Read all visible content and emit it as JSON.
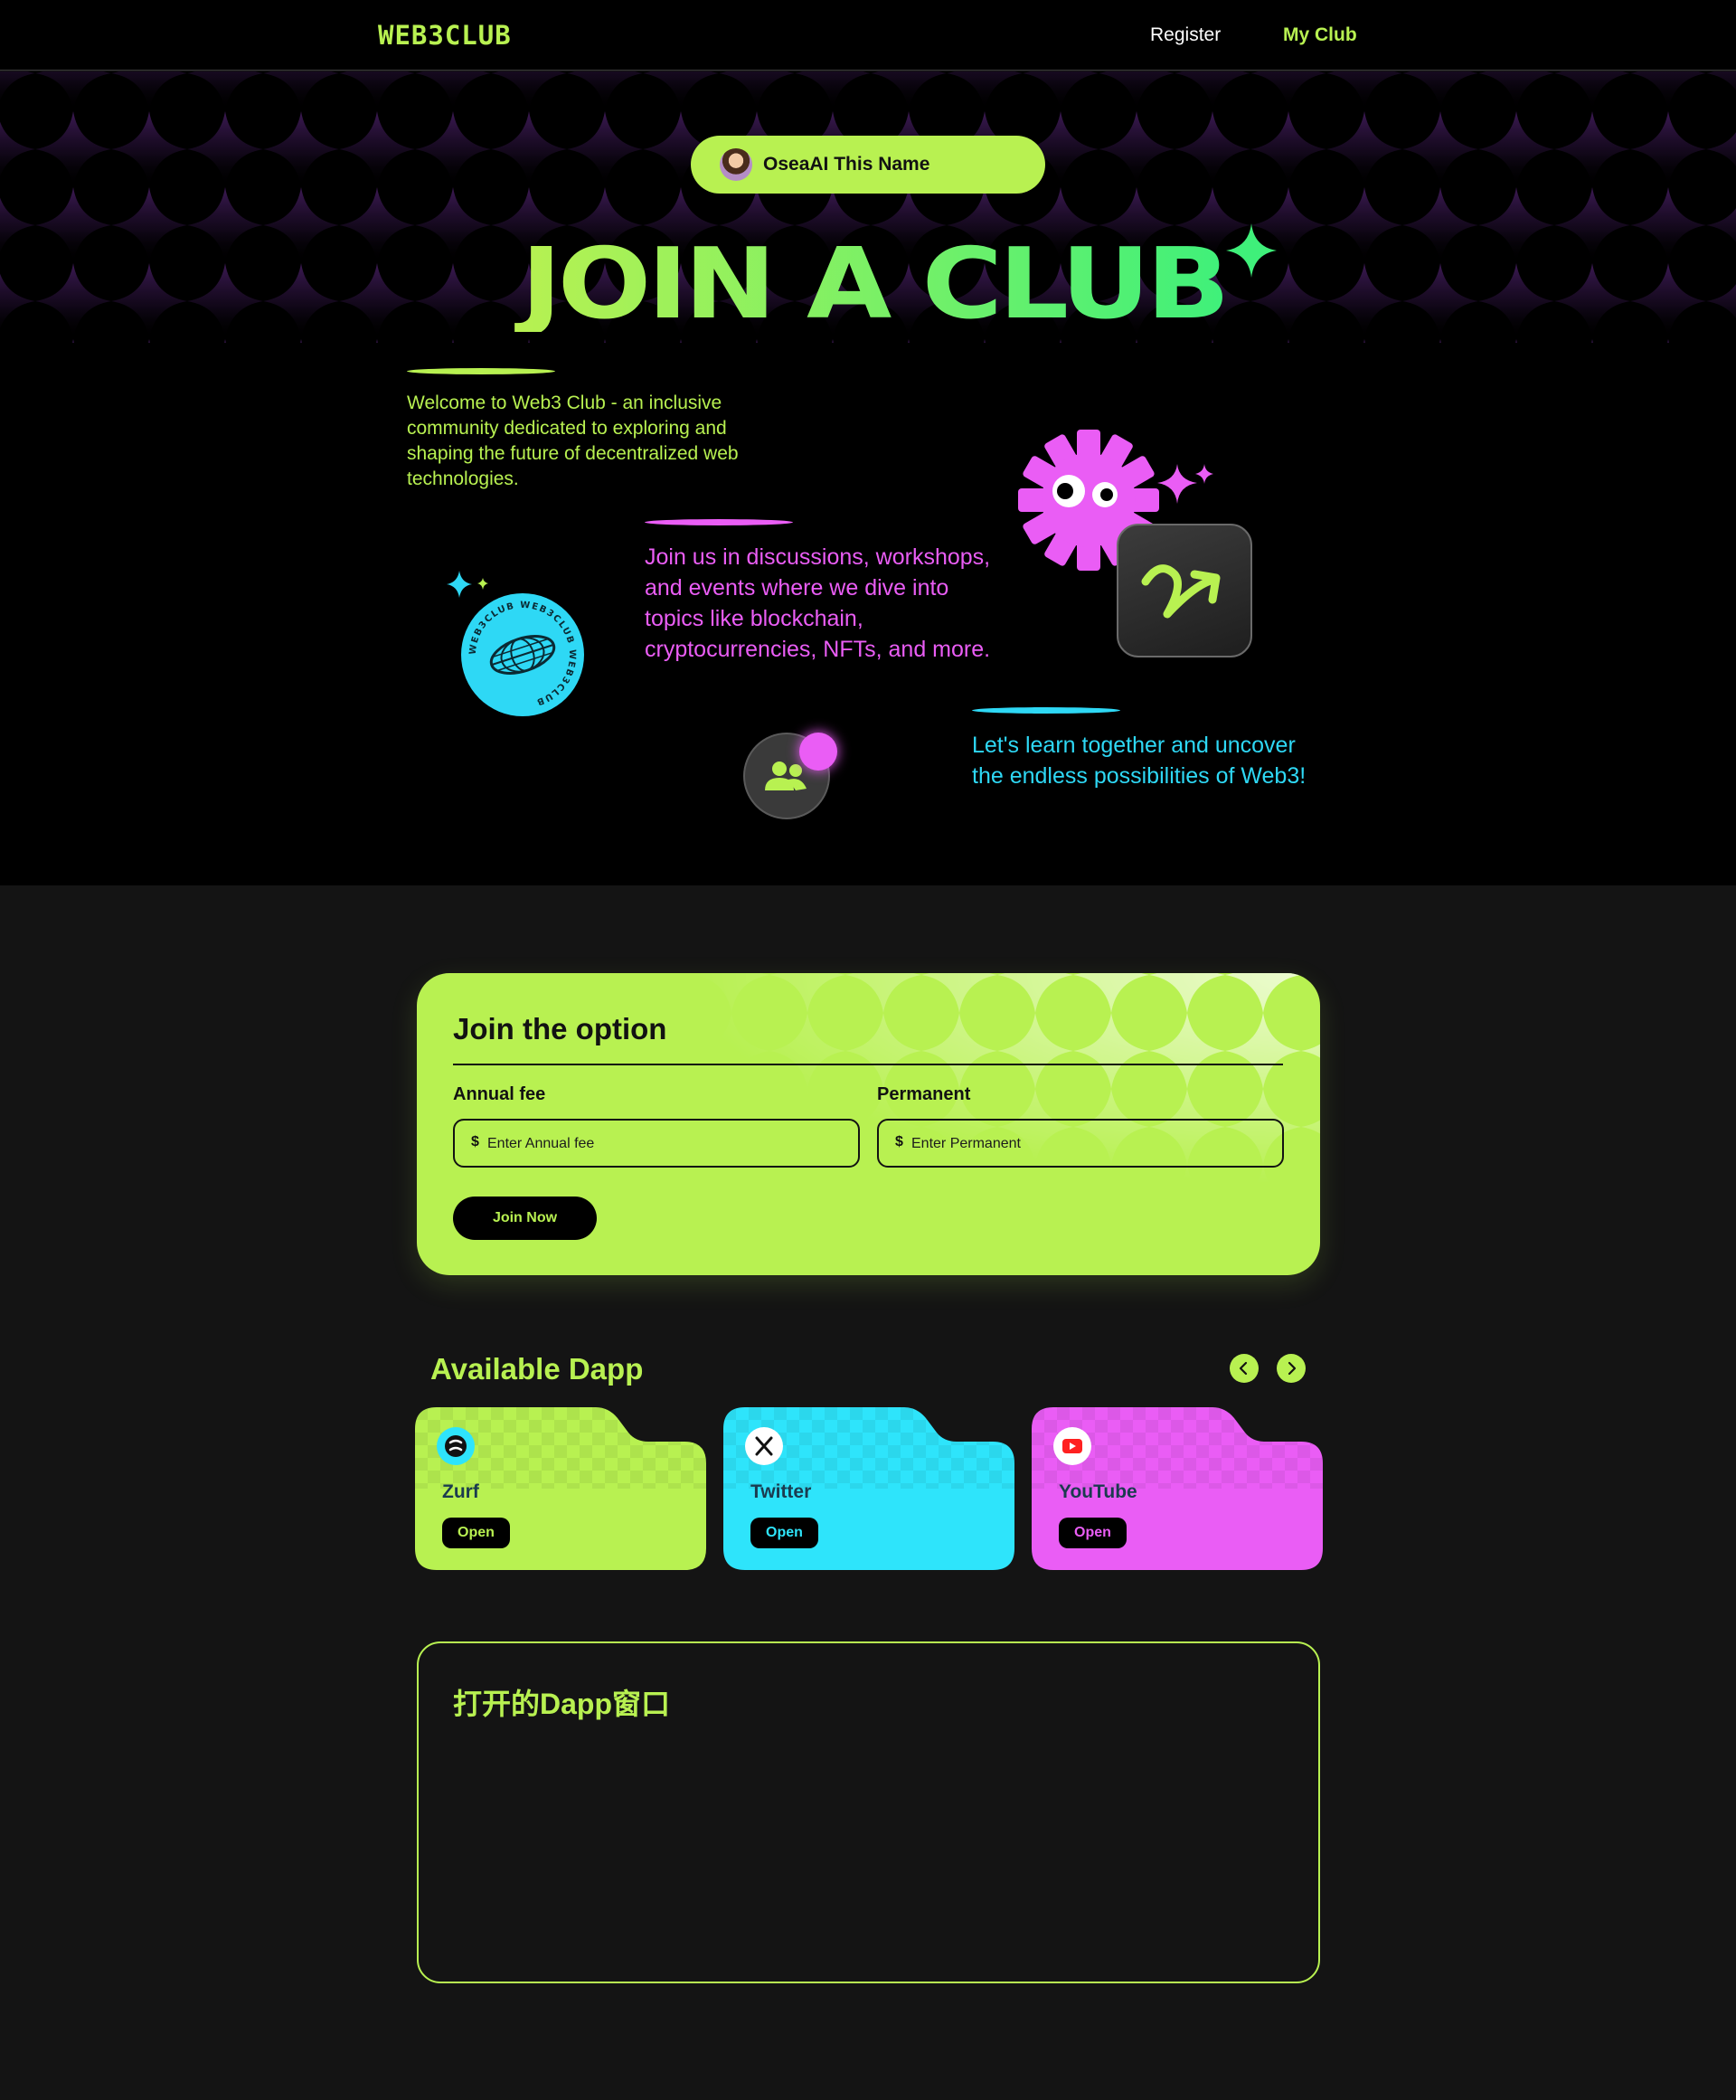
{
  "nav": {
    "logo": "WEB3CLUB",
    "links": [
      {
        "label": "Register"
      },
      {
        "label": "My Club"
      }
    ]
  },
  "hero": {
    "user_name": "OseaAI This Name",
    "title": "JOIN A CLUB",
    "paragraphs": [
      {
        "text": "Welcome to Web3 Club - an inclusive community dedicated to exploring and shaping the future of decentralized web technologies.",
        "color": "#b8f151"
      },
      {
        "text": "Join us in discussions, workshops, and events where we dive into topics like blockchain, cryptocurrencies, NFTs, and more.",
        "color": "#ea5df5"
      },
      {
        "text": "Let's learn together and uncover the endless possibilities of Web3!",
        "color": "#2ed8f5"
      }
    ],
    "badge_text": "WEB3CLUB WEB3CLUB WEB3CLUB",
    "tape_text": "WEB3CLUB"
  },
  "join": {
    "title": "Join the option",
    "annual_label": "Annual fee",
    "annual_placeholder": "Enter Annual fee",
    "permanent_label": "Permanent",
    "permanent_placeholder": "Enter Permanent",
    "currency": "$",
    "button": "Join Now"
  },
  "dapps": {
    "title": "Available Dapp",
    "items": [
      {
        "name": "Zurf",
        "button": "Open",
        "color": "#b8f151",
        "icon": "zurf-icon"
      },
      {
        "name": "Twitter",
        "button": "Open",
        "color": "#2ee4fb",
        "icon": "x-logo-icon"
      },
      {
        "name": "YouTube",
        "button": "Open",
        "color": "#ea5df5",
        "icon": "youtube-icon"
      }
    ]
  },
  "window": {
    "title": "打开的Dapp窗口"
  },
  "colors": {
    "lime": "#b8f151",
    "pink": "#ea5df5",
    "cyan": "#2ed8f5",
    "background": "#141414"
  }
}
